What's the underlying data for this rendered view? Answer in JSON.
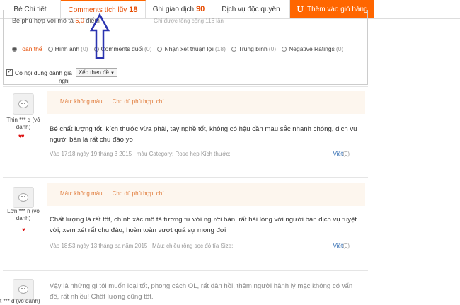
{
  "tabs": [
    {
      "label": "Bé Chi tiết"
    },
    {
      "label": "Comments tích lũy",
      "count": "18"
    },
    {
      "label": "Ghi giao dịch",
      "count": "90"
    },
    {
      "label": "Dịch vụ độc quyền"
    },
    {
      "label": "Thêm vào giỏ hàng",
      "icon": "U"
    }
  ],
  "summary": {
    "line": "Bé phù hợp với mô tả",
    "rating": "5,0",
    "rating_suffix": "điểm",
    "count_line": "Ghi được tổng cộng 116 lần"
  },
  "filters": [
    {
      "label": "Toàn thể",
      "count": "",
      "selected": true
    },
    {
      "label": "Hình ảnh",
      "count": "(0)"
    },
    {
      "label": "Comments đuổi",
      "count": "(0)"
    },
    {
      "label": "Nhận xét thuận lợi",
      "count": "(18)"
    },
    {
      "label": "Trung bình",
      "count": "(0)"
    },
    {
      "label": "Negative Ratings",
      "count": "(0)"
    }
  ],
  "content_filter": {
    "label": "Có nội dung đánh giá",
    "sort_label": "Xếp theo đề",
    "sort_suffix": "nghị"
  },
  "reviews": [
    {
      "user": "Thin *** q (vô danh)",
      "meta_color": "Màu: không màu",
      "meta_fit": "Cho dù phù hợp: chí",
      "text": "Bé chất lượng tốt, kích thước vừa phải, tay nghề tốt, không có hậu cần màu sắc nhanh chóng, dịch vụ người bán là rất chu đáo yo",
      "date": "Vào 17:18 ngày 19 tháng 3 2015",
      "extra": "màu Category: Rose hẹp Kích thước:",
      "reply_label": "Viết",
      "reply_count": "(0)"
    },
    {
      "user": "Lớn *** n (vô danh)",
      "meta_color": "Màu: không màu",
      "meta_fit": "Cho dù phù hợp: chí",
      "text": "Chất lượng là rất tốt, chính xác mô tả tương tự với người bán, rất hài lòng với người bán dịch vụ tuyệt vời, xem xét rất chu đáo, hoàn toàn vượt quá sự mong đợi",
      "date": "Vào 18:53 ngày 13 tháng ba năm 2015",
      "extra": "Màu: chiều rộng sọc đỏ tía Size:",
      "reply_label": "Viết",
      "reply_count": "(0)"
    },
    {
      "user": "t *** d (vô danh)",
      "text": "Vậy là những gì tôi muốn loại tốt, phong cách OL, rất đàn hồi, thêm người hành lý mặc không có vấn đề, rất nhiều! Chất lượng cũng tốt."
    }
  ],
  "colors": {
    "accent": "#f60",
    "count": "#e64b00",
    "link": "#2e6ab1",
    "arrow": "#2a33b0"
  }
}
